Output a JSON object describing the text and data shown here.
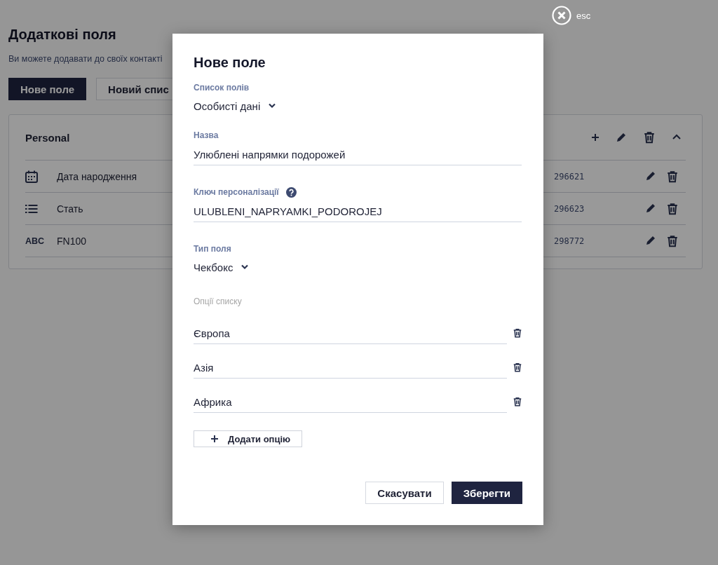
{
  "page": {
    "title": "Додаткові поля",
    "description": "Ви можете додавати до своїх контакті",
    "buttons": [
      {
        "label": "Нове поле",
        "kind": "primary"
      },
      {
        "label": "Новий спис",
        "kind": "secondary"
      }
    ]
  },
  "field_group": {
    "title": "Personal",
    "expanded": true,
    "fields": [
      {
        "kind": "date",
        "name": "Дата народження",
        "id": "296621"
      },
      {
        "kind": "list",
        "name": "Стать",
        "id": "296623"
      },
      {
        "kind": "text",
        "icon_text": "ABC",
        "name": "FN100",
        "id": "298772"
      }
    ]
  },
  "modal": {
    "close_label": "esc",
    "title": "Нове поле",
    "fields": [
      {
        "kind": "select",
        "label": "Список полів",
        "value": "Особисті дані"
      },
      {
        "kind": "input",
        "label": "Назва",
        "value": "Улюблені напрямки подорожей"
      },
      {
        "kind": "input",
        "label": "Ключ персоналізації",
        "help": true,
        "value": "ULUBLENI_NAPRYAMKI_PODOROJEJ"
      },
      {
        "kind": "select",
        "label": "Тип поля",
        "value": "Чекбокс"
      }
    ],
    "options_label": "Опції списку",
    "options": [
      "Європа",
      "Азія",
      "Африка"
    ],
    "add_option": "Додати опцію",
    "buttons": [
      {
        "label": "Скасувати",
        "kind": "secondary"
      },
      {
        "label": "Зберегти",
        "kind": "primary"
      }
    ]
  }
}
